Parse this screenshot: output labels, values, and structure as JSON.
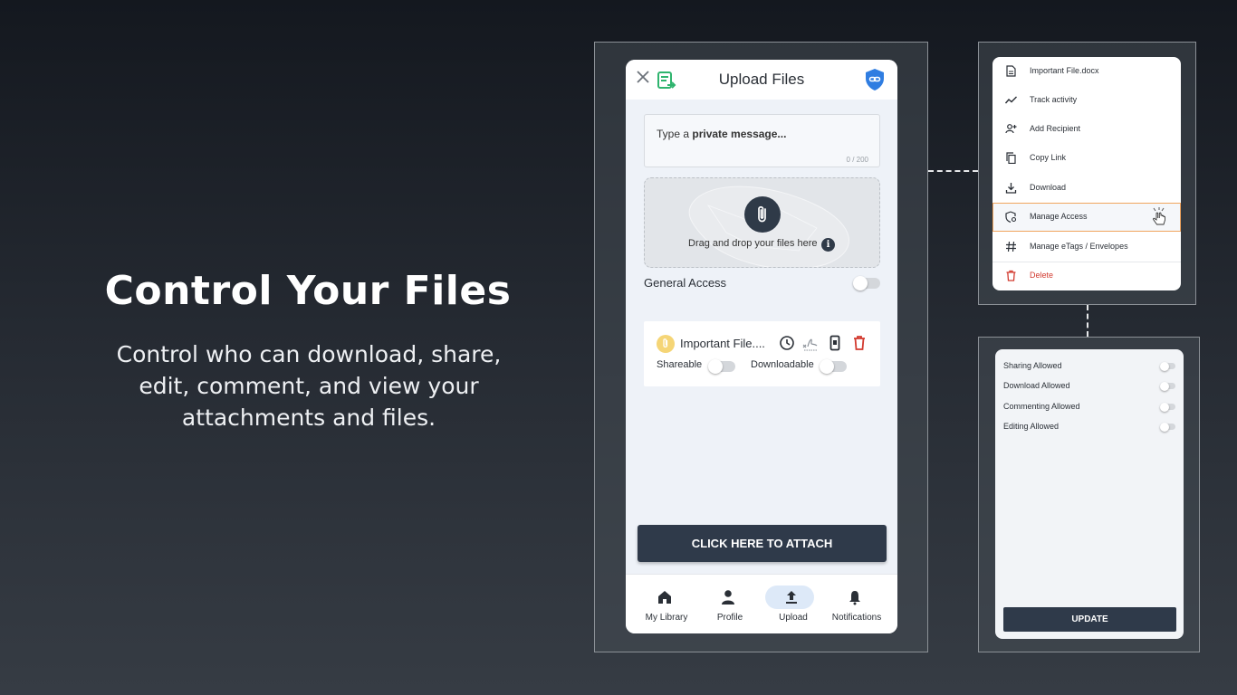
{
  "hero": {
    "title": "Control Your Files",
    "description": "Control who can download, share, edit, comment, and view your attachments and files."
  },
  "phone": {
    "header_title": "Upload Files",
    "message": {
      "placeholder_prefix": "Type a ",
      "placeholder_bold": "private message...",
      "char_count": "0 / 200"
    },
    "dropzone_text": "Drag and drop your files here",
    "general_access_label": "General Access",
    "general_access_on": false,
    "file": {
      "name": "Important File....",
      "shareable_label": "Shareable",
      "downloadable_label": "Downloadable",
      "shareable_on": false,
      "downloadable_on": false
    },
    "attach_button": "CLICK HERE TO ATTACH",
    "nav": [
      {
        "label": "My Library",
        "icon": "home-icon"
      },
      {
        "label": "Profile",
        "icon": "person-icon"
      },
      {
        "label": "Upload",
        "icon": "upload-icon",
        "active": true
      },
      {
        "label": "Notifications",
        "icon": "bell-icon"
      }
    ]
  },
  "menu": {
    "items": [
      {
        "label": "Important File.docx",
        "icon": "document-icon"
      },
      {
        "label": "Track activity",
        "icon": "activity-icon"
      },
      {
        "label": "Add Recipient",
        "icon": "add-person-icon"
      },
      {
        "label": "Copy Link",
        "icon": "copy-icon"
      },
      {
        "label": "Download",
        "icon": "download-icon"
      },
      {
        "label": "Manage Access",
        "icon": "manage-access-icon",
        "active": true
      },
      {
        "label": "Manage eTags / Envelopes",
        "icon": "hash-icon"
      },
      {
        "label": "Delete",
        "icon": "trash-icon",
        "danger": true
      }
    ]
  },
  "permissions": {
    "items": [
      {
        "label": "Sharing Allowed",
        "on": false
      },
      {
        "label": "Download Allowed",
        "on": false
      },
      {
        "label": "Commenting Allowed",
        "on": false
      },
      {
        "label": "Editing Allowed",
        "on": false
      }
    ],
    "update_button": "UPDATE"
  },
  "colors": {
    "accent_dark": "#2f3a4a",
    "brand_blue": "#2f7de1",
    "brand_green": "#2fb46e",
    "danger_red": "#d23a2f",
    "highlight_orange": "#f1a55e"
  }
}
